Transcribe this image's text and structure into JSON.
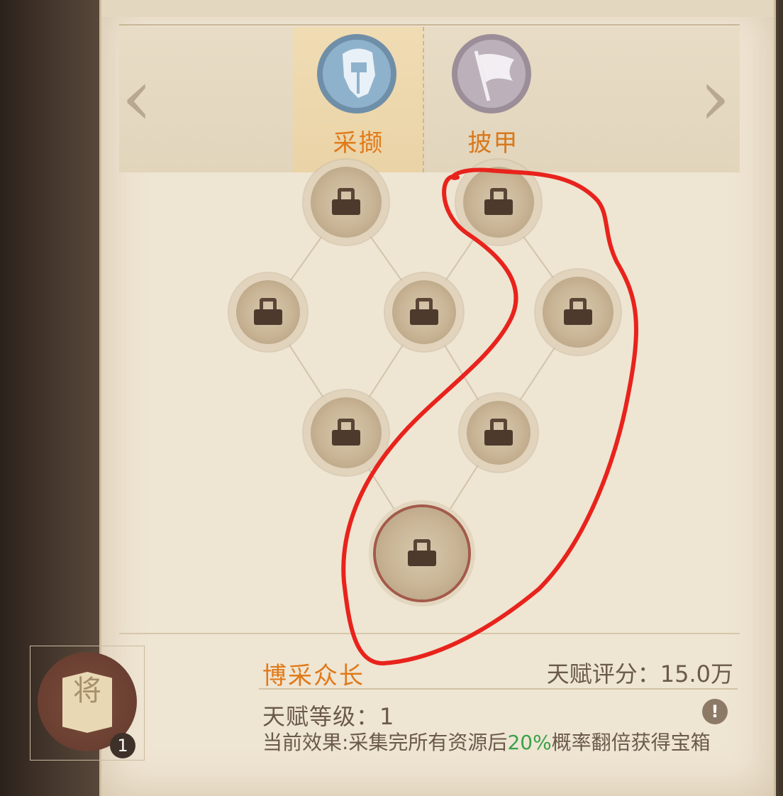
{
  "tabs": [
    {
      "label": "采撷",
      "icon": "gatherer-helmet-icon",
      "active": true,
      "color": "#e07a1a"
    },
    {
      "label": "披甲",
      "icon": "war-banner-icon",
      "active": false,
      "color": "#d8781c"
    }
  ],
  "talent": {
    "name": "博采众长",
    "score": "天赋评分：15.0万",
    "level_text": "天赋等级：1",
    "level_badge": "1",
    "icon_char": "将",
    "effect_prefix": "当前效果:采集完所有资源后",
    "effect_percent": "20%",
    "effect_suffix": "概率翻倍获得宝箱"
  },
  "colors": {
    "accent": "#e07a1a",
    "highlight_green": "#3aa24a",
    "annotation_red": "#e8231c"
  }
}
